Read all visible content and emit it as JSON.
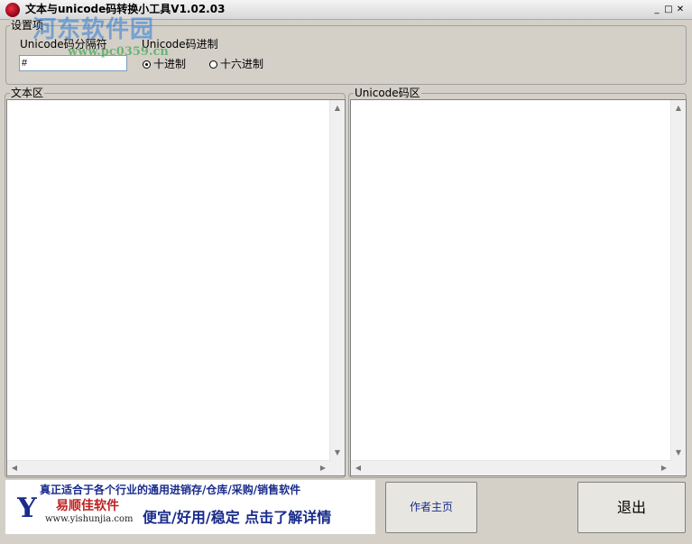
{
  "window": {
    "title": "文本与unicode码转换小工具V1.02.03",
    "minimize": "_",
    "maximize": "□",
    "close": "✕"
  },
  "watermark": {
    "text": "河东软件园",
    "url": "www.pc0359.cn"
  },
  "settings": {
    "group_label": "设置项",
    "separator_label": "Unicode码分隔符",
    "separator_value": "#",
    "radix_label": "Unicode码进制",
    "radix_options": [
      "十进制",
      "十六进制"
    ],
    "radix_selected": "十进制"
  },
  "text_area": {
    "label": "文本区",
    "value": ""
  },
  "unicode_area": {
    "label": "Unicode码区",
    "value": ""
  },
  "banner": {
    "logo": "Y",
    "brand": "易顺佳软件",
    "url": "www.yishunjia.com",
    "line1": "真正适合于各个行业的通用进销存/仓库/采购/销售软件",
    "line2": "便宜/好用/稳定 点击了解详情"
  },
  "buttons": {
    "author_home": "作者主页",
    "exit": "退出"
  }
}
